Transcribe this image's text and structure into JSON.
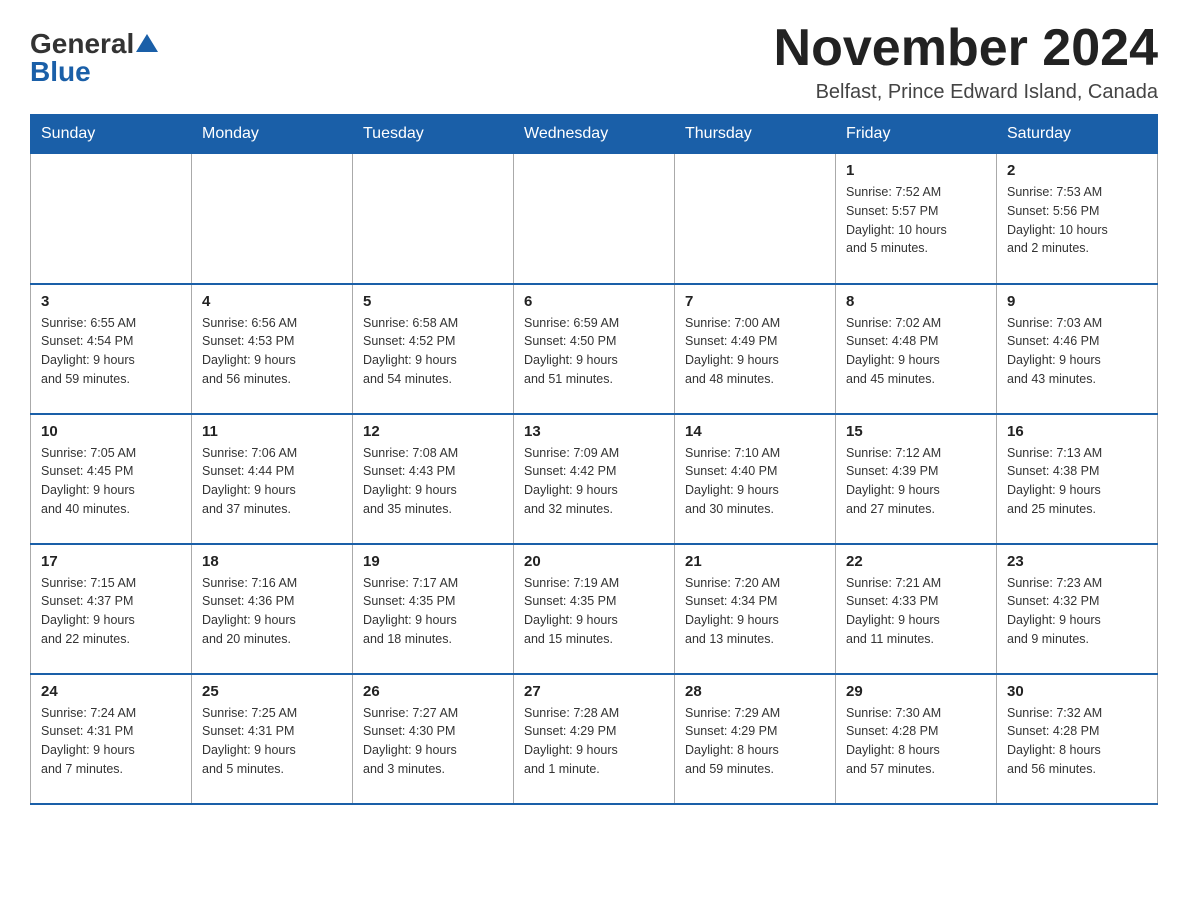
{
  "header": {
    "logo_general": "General",
    "logo_blue": "Blue",
    "month_title": "November 2024",
    "location": "Belfast, Prince Edward Island, Canada"
  },
  "weekdays": [
    "Sunday",
    "Monday",
    "Tuesday",
    "Wednesday",
    "Thursday",
    "Friday",
    "Saturday"
  ],
  "weeks": [
    [
      {
        "day": "",
        "info": ""
      },
      {
        "day": "",
        "info": ""
      },
      {
        "day": "",
        "info": ""
      },
      {
        "day": "",
        "info": ""
      },
      {
        "day": "",
        "info": ""
      },
      {
        "day": "1",
        "info": "Sunrise: 7:52 AM\nSunset: 5:57 PM\nDaylight: 10 hours\nand 5 minutes."
      },
      {
        "day": "2",
        "info": "Sunrise: 7:53 AM\nSunset: 5:56 PM\nDaylight: 10 hours\nand 2 minutes."
      }
    ],
    [
      {
        "day": "3",
        "info": "Sunrise: 6:55 AM\nSunset: 4:54 PM\nDaylight: 9 hours\nand 59 minutes."
      },
      {
        "day": "4",
        "info": "Sunrise: 6:56 AM\nSunset: 4:53 PM\nDaylight: 9 hours\nand 56 minutes."
      },
      {
        "day": "5",
        "info": "Sunrise: 6:58 AM\nSunset: 4:52 PM\nDaylight: 9 hours\nand 54 minutes."
      },
      {
        "day": "6",
        "info": "Sunrise: 6:59 AM\nSunset: 4:50 PM\nDaylight: 9 hours\nand 51 minutes."
      },
      {
        "day": "7",
        "info": "Sunrise: 7:00 AM\nSunset: 4:49 PM\nDaylight: 9 hours\nand 48 minutes."
      },
      {
        "day": "8",
        "info": "Sunrise: 7:02 AM\nSunset: 4:48 PM\nDaylight: 9 hours\nand 45 minutes."
      },
      {
        "day": "9",
        "info": "Sunrise: 7:03 AM\nSunset: 4:46 PM\nDaylight: 9 hours\nand 43 minutes."
      }
    ],
    [
      {
        "day": "10",
        "info": "Sunrise: 7:05 AM\nSunset: 4:45 PM\nDaylight: 9 hours\nand 40 minutes."
      },
      {
        "day": "11",
        "info": "Sunrise: 7:06 AM\nSunset: 4:44 PM\nDaylight: 9 hours\nand 37 minutes."
      },
      {
        "day": "12",
        "info": "Sunrise: 7:08 AM\nSunset: 4:43 PM\nDaylight: 9 hours\nand 35 minutes."
      },
      {
        "day": "13",
        "info": "Sunrise: 7:09 AM\nSunset: 4:42 PM\nDaylight: 9 hours\nand 32 minutes."
      },
      {
        "day": "14",
        "info": "Sunrise: 7:10 AM\nSunset: 4:40 PM\nDaylight: 9 hours\nand 30 minutes."
      },
      {
        "day": "15",
        "info": "Sunrise: 7:12 AM\nSunset: 4:39 PM\nDaylight: 9 hours\nand 27 minutes."
      },
      {
        "day": "16",
        "info": "Sunrise: 7:13 AM\nSunset: 4:38 PM\nDaylight: 9 hours\nand 25 minutes."
      }
    ],
    [
      {
        "day": "17",
        "info": "Sunrise: 7:15 AM\nSunset: 4:37 PM\nDaylight: 9 hours\nand 22 minutes."
      },
      {
        "day": "18",
        "info": "Sunrise: 7:16 AM\nSunset: 4:36 PM\nDaylight: 9 hours\nand 20 minutes."
      },
      {
        "day": "19",
        "info": "Sunrise: 7:17 AM\nSunset: 4:35 PM\nDaylight: 9 hours\nand 18 minutes."
      },
      {
        "day": "20",
        "info": "Sunrise: 7:19 AM\nSunset: 4:35 PM\nDaylight: 9 hours\nand 15 minutes."
      },
      {
        "day": "21",
        "info": "Sunrise: 7:20 AM\nSunset: 4:34 PM\nDaylight: 9 hours\nand 13 minutes."
      },
      {
        "day": "22",
        "info": "Sunrise: 7:21 AM\nSunset: 4:33 PM\nDaylight: 9 hours\nand 11 minutes."
      },
      {
        "day": "23",
        "info": "Sunrise: 7:23 AM\nSunset: 4:32 PM\nDaylight: 9 hours\nand 9 minutes."
      }
    ],
    [
      {
        "day": "24",
        "info": "Sunrise: 7:24 AM\nSunset: 4:31 PM\nDaylight: 9 hours\nand 7 minutes."
      },
      {
        "day": "25",
        "info": "Sunrise: 7:25 AM\nSunset: 4:31 PM\nDaylight: 9 hours\nand 5 minutes."
      },
      {
        "day": "26",
        "info": "Sunrise: 7:27 AM\nSunset: 4:30 PM\nDaylight: 9 hours\nand 3 minutes."
      },
      {
        "day": "27",
        "info": "Sunrise: 7:28 AM\nSunset: 4:29 PM\nDaylight: 9 hours\nand 1 minute."
      },
      {
        "day": "28",
        "info": "Sunrise: 7:29 AM\nSunset: 4:29 PM\nDaylight: 8 hours\nand 59 minutes."
      },
      {
        "day": "29",
        "info": "Sunrise: 7:30 AM\nSunset: 4:28 PM\nDaylight: 8 hours\nand 57 minutes."
      },
      {
        "day": "30",
        "info": "Sunrise: 7:32 AM\nSunset: 4:28 PM\nDaylight: 8 hours\nand 56 minutes."
      }
    ]
  ]
}
